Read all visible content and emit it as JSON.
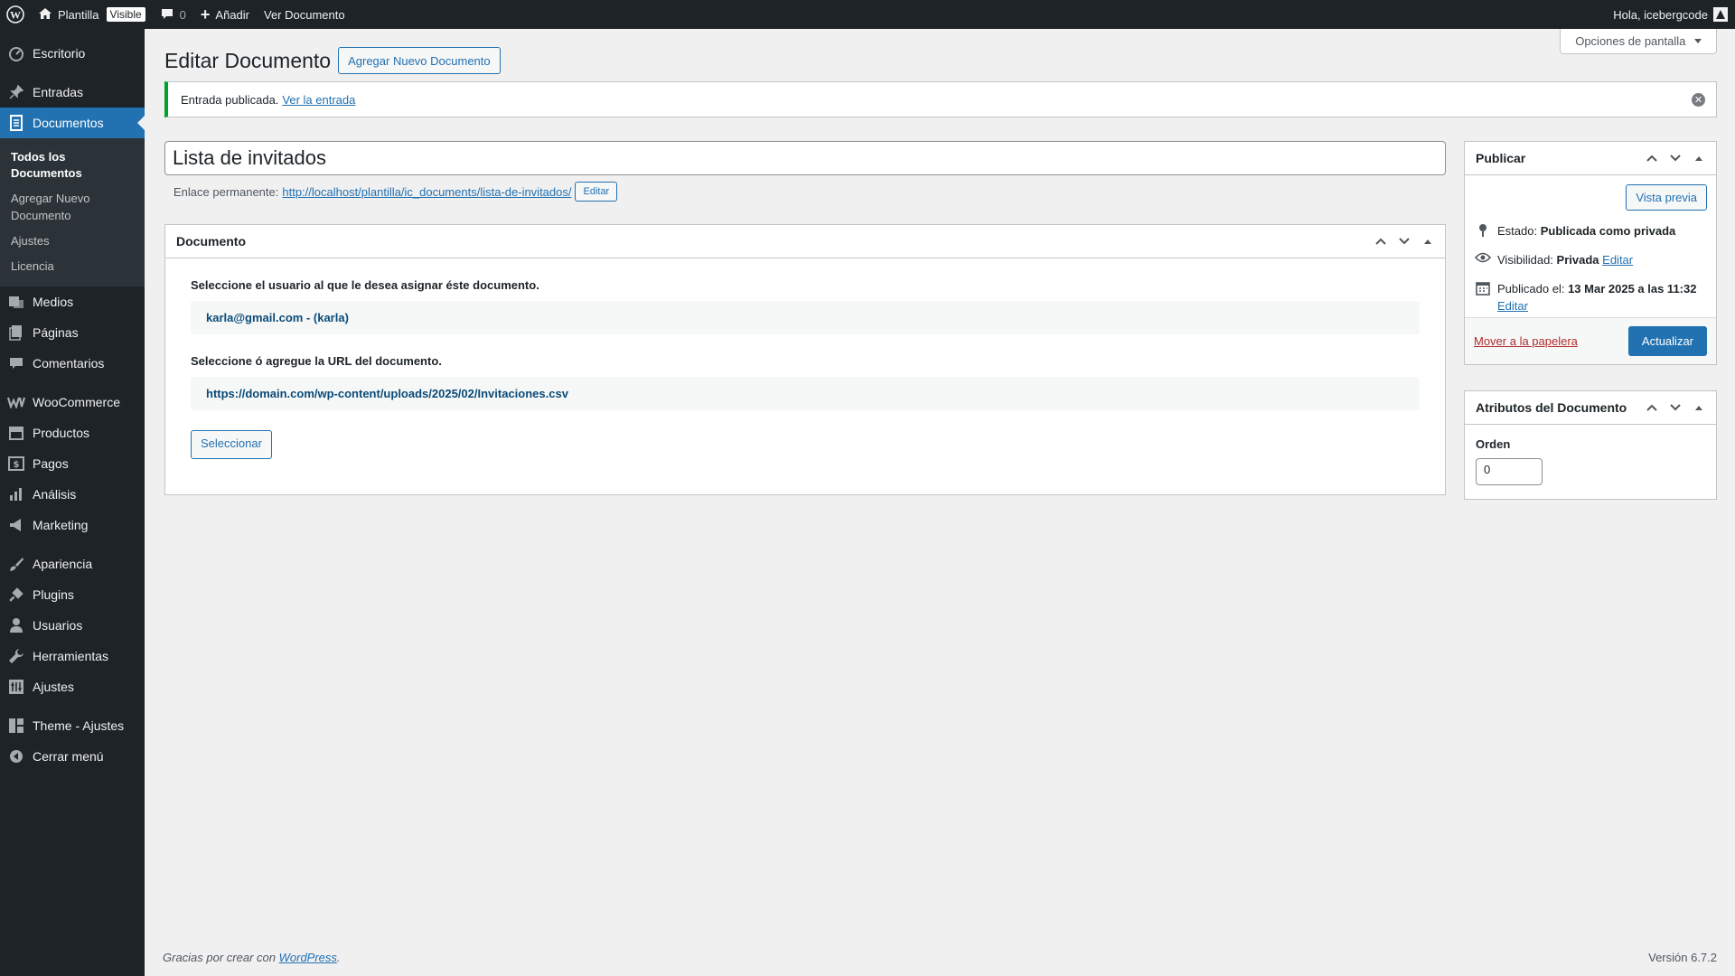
{
  "adminbar": {
    "site_name": "Plantilla",
    "visibility_badge": "Visible",
    "comments_count": "0",
    "add_new": "Añadir",
    "view_post": "Ver Documento",
    "greeting": "Hola, icebergcode"
  },
  "sidebar": {
    "items": [
      {
        "label": "Escritorio",
        "icon": "dashboard-icon"
      },
      {
        "label": "Entradas",
        "icon": "pin-icon"
      },
      {
        "label": "Documentos",
        "icon": "document-icon"
      },
      {
        "label": "Medios",
        "icon": "media-icon"
      },
      {
        "label": "Páginas",
        "icon": "pages-icon"
      },
      {
        "label": "Comentarios",
        "icon": "comment-icon"
      },
      {
        "label": "WooCommerce",
        "icon": "woo-icon"
      },
      {
        "label": "Productos",
        "icon": "archive-icon"
      },
      {
        "label": "Pagos",
        "icon": "dollar-icon"
      },
      {
        "label": "Análisis",
        "icon": "chart-icon"
      },
      {
        "label": "Marketing",
        "icon": "megaphone-icon"
      },
      {
        "label": "Apariencia",
        "icon": "brush-icon"
      },
      {
        "label": "Plugins",
        "icon": "plugin-icon"
      },
      {
        "label": "Usuarios",
        "icon": "user-icon"
      },
      {
        "label": "Herramientas",
        "icon": "wrench-icon"
      },
      {
        "label": "Ajustes",
        "icon": "settings-icon"
      },
      {
        "label": "Theme - Ajustes",
        "icon": "layout-icon"
      },
      {
        "label": "Cerrar menú",
        "icon": "collapse-icon"
      }
    ],
    "submenu": {
      "all": "Todos los Documentos",
      "add": "Agregar Nuevo Documento",
      "settings": "Ajustes",
      "license": "Licencia"
    }
  },
  "header": {
    "screen_options": "Opciones de pantalla",
    "title": "Editar Documento",
    "add_new": "Agregar Nuevo Documento"
  },
  "notice": {
    "text": "Entrada publicada.",
    "link": "Ver la entrada"
  },
  "post": {
    "title": "Lista de invitados",
    "permalink_label": "Enlace permanente:",
    "permalink_base": "http://localhost/plantilla/ic_documents/",
    "permalink_slug": "lista-de-invitados/",
    "permalink_edit": "Editar"
  },
  "document_box": {
    "title": "Documento",
    "user_label": "Seleccione el usuario al que le desea asignar éste documento.",
    "user_value": "karla@gmail.com - (karla)",
    "url_label": "Seleccione ó agregue la URL del documento.",
    "url_value": "https://domain.com/wp-content/uploads/2025/02/Invitaciones.csv",
    "select_button": "Seleccionar"
  },
  "publish_box": {
    "title": "Publicar",
    "preview": "Vista previa",
    "status_label": "Estado:",
    "status_value": "Publicada como privada",
    "visibility_label": "Visibilidad:",
    "visibility_value": "Privada",
    "visibility_edit": "Editar",
    "published_label": "Publicado el:",
    "published_value": "13 Mar 2025 a las 11:32",
    "published_edit": "Editar",
    "trash": "Mover a la papelera",
    "update": "Actualizar"
  },
  "attributes_box": {
    "title": "Atributos del Documento",
    "order_label": "Orden",
    "order_value": "0"
  },
  "footer": {
    "thanks": "Gracias por crear con",
    "wp_link": "WordPress",
    "version": "Versión 6.7.2"
  },
  "colors": {
    "accent": "#2271b1",
    "admin_dark": "#1d2327",
    "success": "#00a32a",
    "danger": "#b32d2e"
  }
}
